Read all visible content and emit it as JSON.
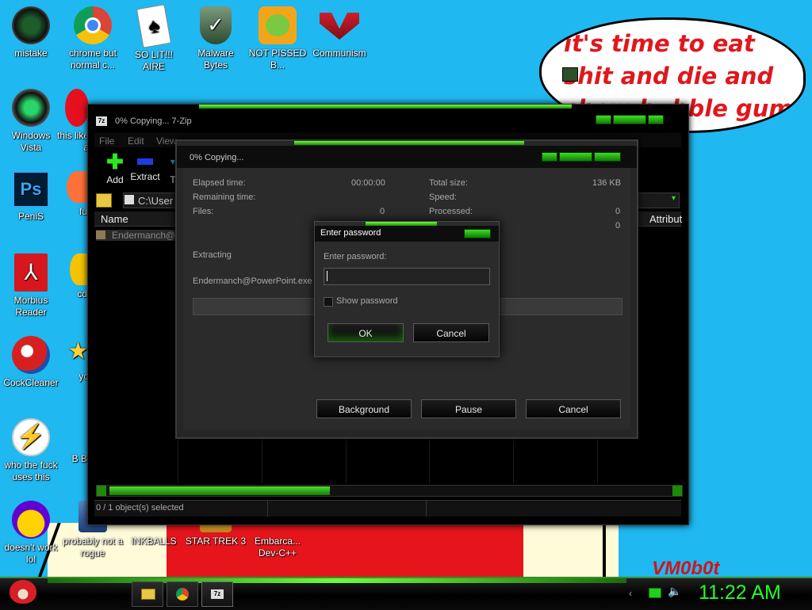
{
  "desktop_icons": [
    {
      "label": "mistake"
    },
    {
      "label": "chrome but normal c..."
    },
    {
      "label": "SO LIT!!! AIRE"
    },
    {
      "label": "Malware Bytes"
    },
    {
      "label": "NOT PISSED B..."
    },
    {
      "label": "Communism"
    },
    {
      "label": "Windows Vista"
    },
    {
      "label": "this like a"
    },
    {
      "label": "PeniS"
    },
    {
      "label": "fu"
    },
    {
      "label": "Morbius Reader"
    },
    {
      "label": "cd"
    },
    {
      "label": "CockCleaner"
    },
    {
      "label": "yo"
    },
    {
      "label": "who the fuck uses this"
    },
    {
      "label": "B B"
    },
    {
      "label": "doesn't work lol"
    },
    {
      "label": "probably not a rogue"
    },
    {
      "label": "INKBALLS"
    },
    {
      "label": "STAR TREK 3"
    },
    {
      "label": "Embarca... Dev-C++"
    }
  ],
  "ps_glyph": "Ps",
  "icon_7z": "7z",
  "wallpaper": {
    "bubble_text": "it's time to eat shit and die and chew bubble gum",
    "signature": "VM0b0t"
  },
  "sevenzip": {
    "title": "0% Copying... 7-Zip",
    "menu": [
      "File",
      "Edit",
      "View"
    ],
    "toolbar": {
      "add": "Add",
      "extract": "Extract",
      "test": "T"
    },
    "address": "C:\\User",
    "columns": {
      "name": "Name",
      "attributes": "Attribut"
    },
    "file_row": "Endermanch@",
    "status": "0 / 1 object(s) selected"
  },
  "copy_dialog": {
    "title": "0% Copying...",
    "elapsed_label": "Elapsed time:",
    "elapsed_value": "00:00:00",
    "remaining_label": "Remaining time:",
    "files_label": "Files:",
    "files_value": "0",
    "total_size_label": "Total size:",
    "total_size_value": "136 KB",
    "speed_label": "Speed:",
    "processed_label": "Processed:",
    "processed_value": "0",
    "extra_value": "0",
    "operation": "Extracting",
    "current_file": "Endermanch@PowerPoint.exe",
    "background_button": "Background",
    "pause_button": "Pause",
    "cancel_button": "Cancel"
  },
  "password_dialog": {
    "title": "Enter password",
    "prompt": "Enter password:",
    "show_password": "Show password",
    "ok": "OK",
    "cancel": "Cancel"
  },
  "taskbar": {
    "clock": "11:22 AM",
    "colors": {
      "clock": "#22ff22",
      "accent": "#3fd11f"
    }
  }
}
